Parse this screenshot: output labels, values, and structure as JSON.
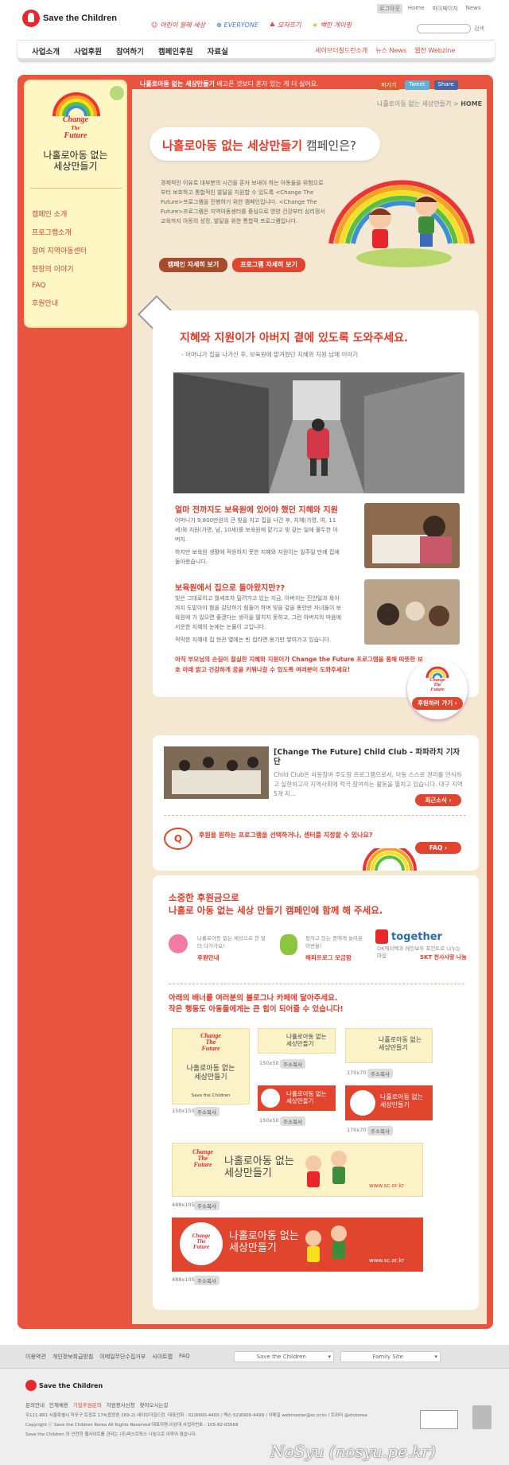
{
  "header": {
    "logo_text": "Save the Children",
    "sponsors": [
      "어린이 알래 세상",
      "EVERYONE",
      "모자뜨기",
      "백만 게이핑"
    ],
    "util_links": [
      "로그아웃",
      "Home",
      "마이페이지",
      "News"
    ],
    "search_label": "검색"
  },
  "gnb": {
    "items": [
      "사업소개",
      "사업후원",
      "참여하기",
      "캠페인후원",
      "자료실"
    ],
    "right": [
      "세이브더칠드런소개",
      "뉴스 News",
      "웹진 Webzine"
    ]
  },
  "topline": {
    "bold": "나홀로아동 없는 세상만들기",
    "rest": "배고픈 것보다 혼자 있는 게 더 싫어요."
  },
  "social": [
    "퍼가기",
    "Tweet",
    "Share"
  ],
  "breadcrumb": {
    "path": "나홀로아동 없는 세상만들기",
    "current": "HOME"
  },
  "sidebar": {
    "logo": [
      "Change",
      "The",
      "Future"
    ],
    "title_line1": "나홀로아동 없는",
    "title_line2": "세상만들기",
    "menu": [
      "캠페인 소개",
      "프로그램소개",
      "참여 지역아동센터",
      "현장의 이야기",
      "FAQ",
      "후원안내"
    ]
  },
  "intro": {
    "title_main": "나홀로아동 없는 세상만들기",
    "title_rest": " 캠페인은?",
    "body": "경제적인 이유로 대부분의 시간을 혼자 보내야 하는 아동들을 위험으로부터 보호하고 통합적인 발달을 지원할 수 있도록 <Change The Future>프로그램을 진행하기 위한 캠페인입니다. <Change The Future>프로그램은 지역아동센터를 중심으로 영양 건강부터 심리정서 교육까지 아동의 성장, 발달을 위한 통합적 프로그램입니다.",
    "btn1": "캠페인 자세히 보기",
    "btn2": "프로그램 자세히 보기"
  },
  "story": {
    "headline": "지혜와 지원이가 아버지 곁에 있도록 도와주세요.",
    "sub": "- 어머니가 집을 나가신 후, 보육원에 맡겨졌던 지혜와 지원 남매 이야기",
    "s1_title": "얼마 전까지도 보육원에 있어야 했던 지혜와 지원",
    "s1_p1": "어머니가 9,800만원의 큰 빚을 지고 집을 나간 후, 지혜(가명, 여, 11세)와 지원(가명, 남, 10세)를 보육원에 맡기고 빚 갚는 일에 몰두한 아버지.",
    "s1_p2": "하지만 보육원 생활에 적응하지 못한 지혜와 지원이는 일주일 만에 집에 돌아왔습니다.",
    "s2_title": "보육원에서 집으로 돌아왔지만??",
    "s2_p1": "빚은 그대로이고 월세조차 밀려가고 있는 지금, 아버지는 진안일과 육아까지 도맡아야 함을 감당하기 힘들어 하며 빚을 갚을 동안만 자녀들이 보육원에 가 있으면 좋겠다는 생각을 떨치지 못하고, 그런 아버지의 마음에 서운한 지혜의 눈에는 눈물이 고입니다.",
    "s2_p2": "적막한 지혜네 집 현관 옆에는 빈 컵라면 용기만 쌓여가고 있습니다.",
    "appeal": "아직 부모님의 손길이 절실한 지혜와 지원이가 Change the Future 프로그램을 통해 따뜻한 보호 아래 밝고 건강하게 꿈을 키워나갈 수 있도록 여러분이 도와주세요!",
    "donate_btn": "후원하러 가기 ›"
  },
  "news": {
    "title": "[Change The Future] Child Club - 파파라치 기자단",
    "body": "Child Club은 아동참여 주도형 프로그램으로서, 아동 스스로 권리를 인식하고 실현하고자 지역사회에 적극 참여하는 활동을 펼치고 있습니다. 대구 지역 5개 지...",
    "btn": "최근소식 ›"
  },
  "faq": {
    "question": "후원을 원하는 프로그램을 선택하거나, 센터를 지정할 수 있나요?",
    "btn": "FAQ ›"
  },
  "support": {
    "title1": "소중한 후원금으로",
    "title2": "나홀로 아동 없는 세상 만들기 캠페인에 함께 해 주세요.",
    "opt1_text": "나홀로아동 없는 세상으로 한 발 더 다가가요!",
    "opt1_link": "후원안내",
    "opt2_text": "잠자고 있는 콩에게 놀라운 이변을!",
    "opt2_link": "해피프로그 모금함",
    "opt3_brand": "together",
    "opt3_text": "OK캐쉬백과 레인보우 포인트로 나누는 마음",
    "opt3_link": "SKT 천사사랑 나눔"
  },
  "banners": {
    "title1": "아래의 배너를 여러분의 블로그나 카페에 달아주세요.",
    "title2": "작은 행동도 아동들에게는 큰 힘이 되어줄 수 있습니다!",
    "line1": "나홀로아동 없는",
    "line2": "세상만들기",
    "sizes": [
      "150x150",
      "150x50",
      "170x70",
      "150x50",
      "170x70",
      "488x105",
      "488x105"
    ],
    "copy": "주소복사",
    "url": "www.sc.or.kr",
    "org": "Save the Children"
  },
  "footer": {
    "links": [
      "이용약관",
      "개인정보취급방침",
      "이메일무단수집거부",
      "사이트맵",
      "FAQ"
    ],
    "select1": "Save the Children",
    "select2": "Family Site",
    "logo": "Save the Children",
    "links2": [
      "문의안내",
      "인재채용",
      "기업후원문의",
      "자원봉사신청",
      "찾아오시는길"
    ],
    "address": "우121-881 서울특별시 마포구 토정로 174(합정동 169-2) 세이브더칠드런. 대표전화 : 02)6900-4400 / 팩스 02)6900-4499 / 이메일 webmaster@sc.or.kr / 트위터 @stckorea",
    "copyright": "Copyright ⓒ Save the Children Korea All Rights Reserved  대표자명:이상대  사업자번호 : 105-82-03569",
    "copyright2": "Save the Children 의 안전한 웹사이트를 관리는 (주)퍼스트웍스 나눔으로 이루어 졌습니다.",
    "watermark": "NoSyu (nosyu.pe.kr)"
  }
}
